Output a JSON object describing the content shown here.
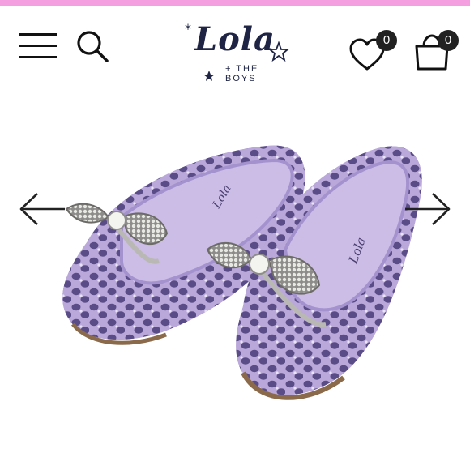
{
  "brand": {
    "name": "Lola",
    "tagline": "+ THE BOYS",
    "accent_color": "#f49fe0",
    "ink_color": "#1f2444"
  },
  "header": {
    "icons": [
      "menu-icon",
      "search-icon",
      "heart-icon",
      "shopping-bag-icon"
    ],
    "wishlist_count": "0",
    "cart_count": "0"
  },
  "product": {
    "image": "lavender perforated ballet flats with rhinestone bow",
    "color": "#b9a8d9",
    "shoe_brand_stamp": "Lola + THE BOYS"
  },
  "carousel": {
    "prev_icon": "arrow-left-icon",
    "next_icon": "arrow-right-icon"
  }
}
